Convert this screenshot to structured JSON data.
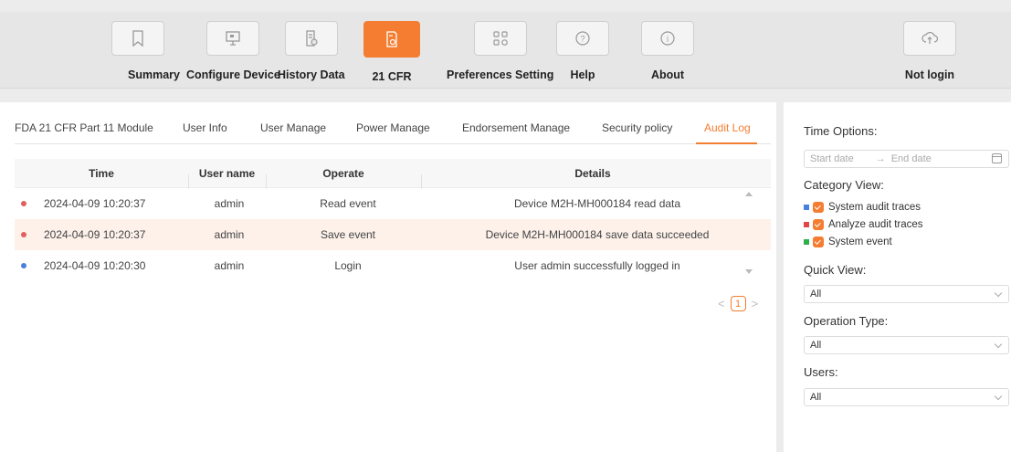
{
  "toolbar": {
    "items": [
      {
        "label": "Summary",
        "icon": "bookmark-icon"
      },
      {
        "label": "Configure Device",
        "icon": "monitor-icon"
      },
      {
        "label": "History Data",
        "icon": "history-doc-icon"
      },
      {
        "label": "21 CFR",
        "icon": "cfr-doc-icon"
      },
      {
        "label": "Preferences Setting",
        "icon": "grid-settings-icon"
      },
      {
        "label": "Help",
        "icon": "question-icon"
      },
      {
        "label": "About",
        "icon": "info-icon"
      },
      {
        "label": "Not login",
        "icon": "cloud-upload-icon"
      }
    ],
    "accent": "#f47d31"
  },
  "tabs": [
    "FDA 21 CFR Part 11 Module",
    "User Info",
    "User Manage",
    "Power Manage",
    "Endorsement Manage",
    "Security policy",
    "Audit Log"
  ],
  "active_tab": "Audit Log",
  "table": {
    "headers": {
      "time": "Time",
      "user": "User name",
      "operate": "Operate",
      "details": "Details"
    },
    "rows": [
      {
        "dot": "#e06060",
        "time": "2024-04-09 10:20:37",
        "user": "admin",
        "operate": "Read event",
        "details": "Device M2H-MH000184 read data"
      },
      {
        "dot": "#e06060",
        "time": "2024-04-09 10:20:37",
        "user": "admin",
        "operate": "Save event",
        "details": "Device M2H-MH000184 save data succeeded"
      },
      {
        "dot": "#4a7fe0",
        "time": "2024-04-09 10:20:30",
        "user": "admin",
        "operate": "Login",
        "details": "User admin successfully logged in"
      }
    ]
  },
  "pager": {
    "prev": "<",
    "page": "1",
    "next": ">"
  },
  "side": {
    "time_options_label": "Time Options:",
    "start_placeholder": "Start date",
    "arrow": "→",
    "end_placeholder": "End date",
    "category_label": "Category View:",
    "categories": [
      {
        "label": "System audit traces",
        "color": "#4a7fe0"
      },
      {
        "label": "Analyze audit traces",
        "color": "#e04848"
      },
      {
        "label": "System event",
        "color": "#2fae4a"
      }
    ],
    "quick_view_label": "Quick View:",
    "quick_view_value": "All",
    "operation_type_label": "Operation Type:",
    "operation_type_value": "All",
    "users_label": "Users:",
    "users_value": "All"
  }
}
